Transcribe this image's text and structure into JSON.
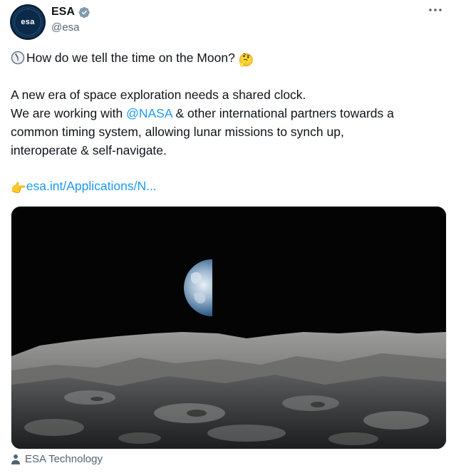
{
  "author": {
    "display_name": "ESA",
    "handle": "@esa",
    "avatar_text": "esa"
  },
  "tweet": {
    "line1": "How do we tell the time on the Moon?",
    "line1_emoji": "🤔",
    "line2": "A new era of space exploration needs a shared clock.",
    "line3_prefix": "We are working with ",
    "line3_mention": "@NASA",
    "line3_suffix": " & other international partners towards a",
    "line4": "common timing system, allowing lunar missions to synch up,",
    "line5": "interoperate & self-navigate.",
    "link_emoji": "👉",
    "link_text": "esa.int/Applications/N..."
  },
  "media": {
    "description_icon": "earthrise-over-lunar-surface"
  },
  "attribution": {
    "label": "ESA Technology"
  },
  "colors": {
    "link": "#1d9bf0",
    "secondary_text": "#536471",
    "verified_badge": "#829aab"
  },
  "icons": [
    "clock-icon",
    "verified-badge-icon",
    "more-options-icon",
    "person-icon"
  ]
}
